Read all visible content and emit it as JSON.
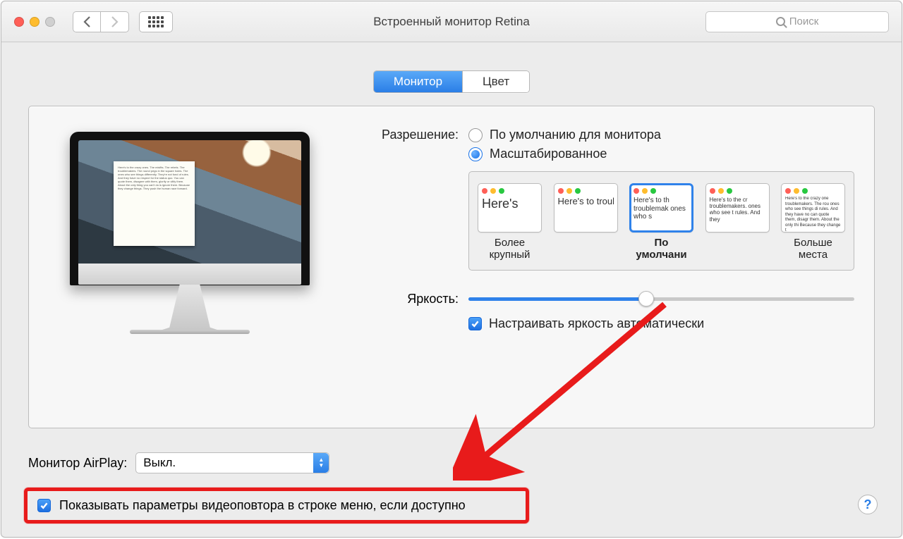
{
  "window": {
    "title": "Встроенный монитор Retina",
    "search_placeholder": "Поиск"
  },
  "tabs": {
    "display": "Монитор",
    "color": "Цвет"
  },
  "resolution": {
    "label": "Разрешение:",
    "option_default": "По умолчанию для монитора",
    "option_scaled": "Масштабированное",
    "selected": "scaled",
    "cards": [
      {
        "sample": "Here's",
        "label": "Более крупный"
      },
      {
        "sample": "Here's to troublem",
        "label": ""
      },
      {
        "sample": "Here's to th troublemak ones who s",
        "label": "По умолчани"
      },
      {
        "sample": "Here's to the cr troublemakers. ones who see t rules. And they",
        "label": ""
      },
      {
        "sample": "Here's to the crazy one troublemakers. The rou ones who see things di rules. And they have no can quote them, disagr them. About the only thi Because they change t",
        "label": "Больше места"
      }
    ]
  },
  "brightness": {
    "label": "Яркость:",
    "auto_label": "Настраивать яркость автоматически",
    "auto_checked": true,
    "value_pct": 46
  },
  "airplay": {
    "label": "Монитор AirPlay:",
    "value": "Выкл."
  },
  "mirroring": {
    "label": "Показывать параметры видеоповтора в строке меню, если доступно",
    "checked": true
  },
  "help": "?"
}
